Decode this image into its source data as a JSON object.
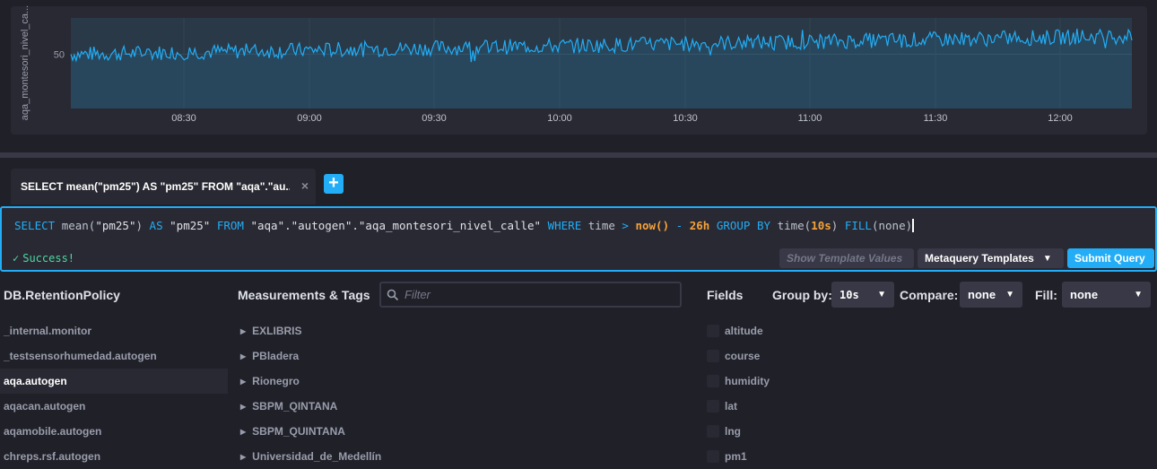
{
  "graph": {
    "y_axis_label": "aqa_montesori_nivel_ca...",
    "y_tick": "50",
    "x_ticks": [
      "08:30",
      "09:00",
      "09:30",
      "10:00",
      "10:30",
      "11:00",
      "11:30",
      "12:00"
    ],
    "line_color": "#22adf6"
  },
  "chart_data": {
    "type": "area",
    "ylabel": "aqa_montesori_nivel_ca...",
    "x_ticks": [
      "08:30",
      "09:00",
      "09:30",
      "10:00",
      "10:30",
      "11:00",
      "11:30",
      "12:00"
    ],
    "y_ticks": [
      50
    ],
    "trend": {
      "start": 50,
      "end": 54
    }
  },
  "tabs": [
    {
      "label": "SELECT mean(\"pm25\") AS \"pm25\" FROM \"aqa\".\"au...",
      "close": "×"
    }
  ],
  "add_tab_label": "+",
  "editor": {
    "q": {
      "select": "SELECT",
      "mean": "mean(",
      "field": "\"pm25\"",
      "close_paren": ")",
      "as": "AS",
      "alias": "\"pm25\"",
      "from": "FROM",
      "measurement": "\"aqa\".\"autogen\".\"aqa_montesori_nivel_calle\"",
      "where": "WHERE",
      "time": "time",
      "gt": ">",
      "now": "now()",
      "minus": "-",
      "dur": "26h",
      "group": "GROUP BY",
      "time_fn": "time(",
      "interval": "10s",
      "fill": "FILL",
      "fill_arg": "(none)"
    },
    "status": "Success!",
    "show_template_values": "Show Template Values",
    "metaquery_templates": "Metaquery Templates",
    "submit": "Submit Query"
  },
  "schema": {
    "db_header": "DB.RetentionPolicy",
    "databases": [
      "_internal.monitor",
      "_testsensorhumedad.autogen",
      "aqa.autogen",
      "aqacan.autogen",
      "aqamobile.autogen",
      "chreps.rsf.autogen"
    ],
    "active_db_index": 2,
    "measurements_header": "Measurements & Tags",
    "filter_placeholder": "Filter",
    "measurements": [
      "EXLIBRIS",
      "PBladera",
      "Rionegro",
      "SBPM_QINTANA",
      "SBPM_QUINTANA",
      "Universidad_de_Medellín"
    ],
    "fields_header": "Fields",
    "fields": [
      "altitude",
      "course",
      "humidity",
      "lat",
      "lng",
      "pm1"
    ],
    "group_by_label": "Group by:",
    "group_by_value": "10s",
    "compare_label": "Compare:",
    "compare_value": "none",
    "fill_label": "Fill:",
    "fill_value": "none"
  }
}
